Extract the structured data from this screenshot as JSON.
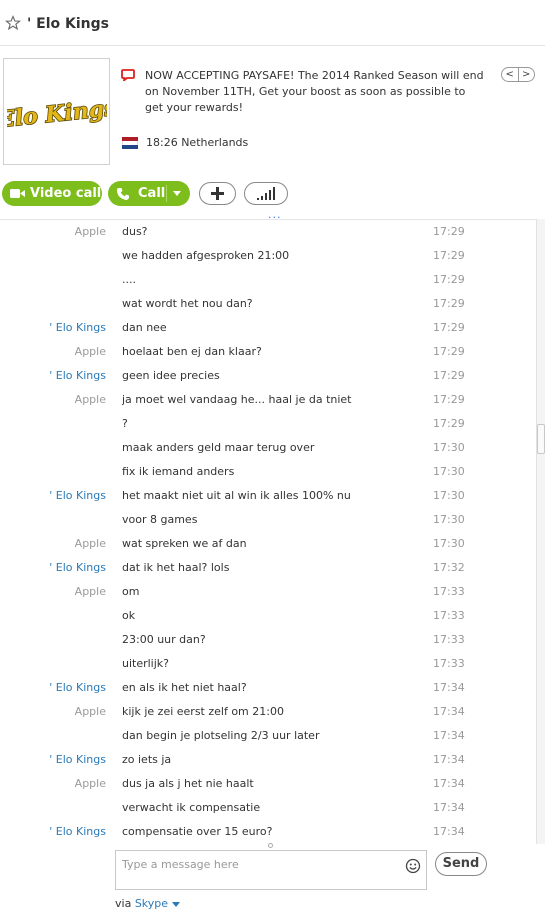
{
  "header": {
    "title": "' Elo Kings",
    "favorite_icon": "star-outline-icon"
  },
  "profile": {
    "logo_text": "Elo Kings",
    "mood_icon": "mood-message-icon",
    "mood": "NOW ACCEPTING PAYSAFE! The 2014 Ranked Season will end on November 11TH, Get your boost as soon as possible to get your rewards!",
    "nav_prev": "<",
    "nav_next": ">",
    "local_time": "18:26 Netherlands",
    "flag": {
      "name": "netherlands-flag",
      "colors": [
        "#ae1c28",
        "#ffffff",
        "#21468b"
      ]
    }
  },
  "actions": {
    "video_call_label": "Video call",
    "call_label": "Call",
    "add_icon": "plus-icon",
    "signal_icon": "signal-bars-icon",
    "more": "..."
  },
  "messages": [
    {
      "sender": "Apple",
      "text": "dus?",
      "time": "17:29"
    },
    {
      "sender": "",
      "text": "we hadden afgesproken 21:00",
      "time": "17:29"
    },
    {
      "sender": "",
      "text": "....",
      "time": "17:29"
    },
    {
      "sender": "",
      "text": "wat wordt het nou dan?",
      "time": "17:29"
    },
    {
      "sender": "' Elo Kings",
      "text": "dan nee",
      "time": "17:29"
    },
    {
      "sender": "Apple",
      "text": "hoelaat ben ej dan klaar?",
      "time": "17:29"
    },
    {
      "sender": "' Elo Kings",
      "text": "geen idee precies",
      "time": "17:29"
    },
    {
      "sender": "Apple",
      "text": "ja moet wel vandaag he... haal je da tniet",
      "time": "17:29"
    },
    {
      "sender": "",
      "text": "?",
      "time": "17:29"
    },
    {
      "sender": "",
      "text": "maak anders geld maar terug over",
      "time": "17:30"
    },
    {
      "sender": "",
      "text": "fix ik iemand anders",
      "time": "17:30"
    },
    {
      "sender": "' Elo Kings",
      "text": "het maakt niet uit al win ik alles 100% nu",
      "time": "17:30"
    },
    {
      "sender": "",
      "text": "voor 8 games",
      "time": "17:30"
    },
    {
      "sender": "Apple",
      "text": "wat spreken we af dan",
      "time": "17:30"
    },
    {
      "sender": "' Elo Kings",
      "text": "dat ik het haal? lols",
      "time": "17:32"
    },
    {
      "sender": "Apple",
      "text": "om",
      "time": "17:33"
    },
    {
      "sender": "",
      "text": "ok",
      "time": "17:33"
    },
    {
      "sender": "",
      "text": "23:00 uur dan?",
      "time": "17:33"
    },
    {
      "sender": "",
      "text": "uiterlijk?",
      "time": "17:33"
    },
    {
      "sender": "' Elo Kings",
      "text": "en als ik het niet haal?",
      "time": "17:34"
    },
    {
      "sender": "Apple",
      "text": "kijk je zei eerst zelf om 21:00",
      "time": "17:34"
    },
    {
      "sender": "",
      "text": "dan begin je plotseling 2/3 uur later",
      "time": "17:34"
    },
    {
      "sender": "' Elo Kings",
      "text": "zo iets ja",
      "time": "17:34"
    },
    {
      "sender": "Apple",
      "text": "dus ja als j het nie haalt",
      "time": "17:34"
    },
    {
      "sender": "",
      "text": "verwacht ik compensatie",
      "time": "17:34"
    },
    {
      "sender": "' Elo Kings",
      "text": "compensatie over 15 euro?",
      "time": "17:34"
    }
  ],
  "composer": {
    "placeholder": "Type a message here",
    "value": "",
    "emoticon_icon": "smiley-icon",
    "send_label": "Send",
    "via_label": "via",
    "via_service": "Skype"
  },
  "colors": {
    "accent_green": "#7dbd1c",
    "link_blue": "#2a7ab8",
    "muted_gray": "#999999"
  }
}
